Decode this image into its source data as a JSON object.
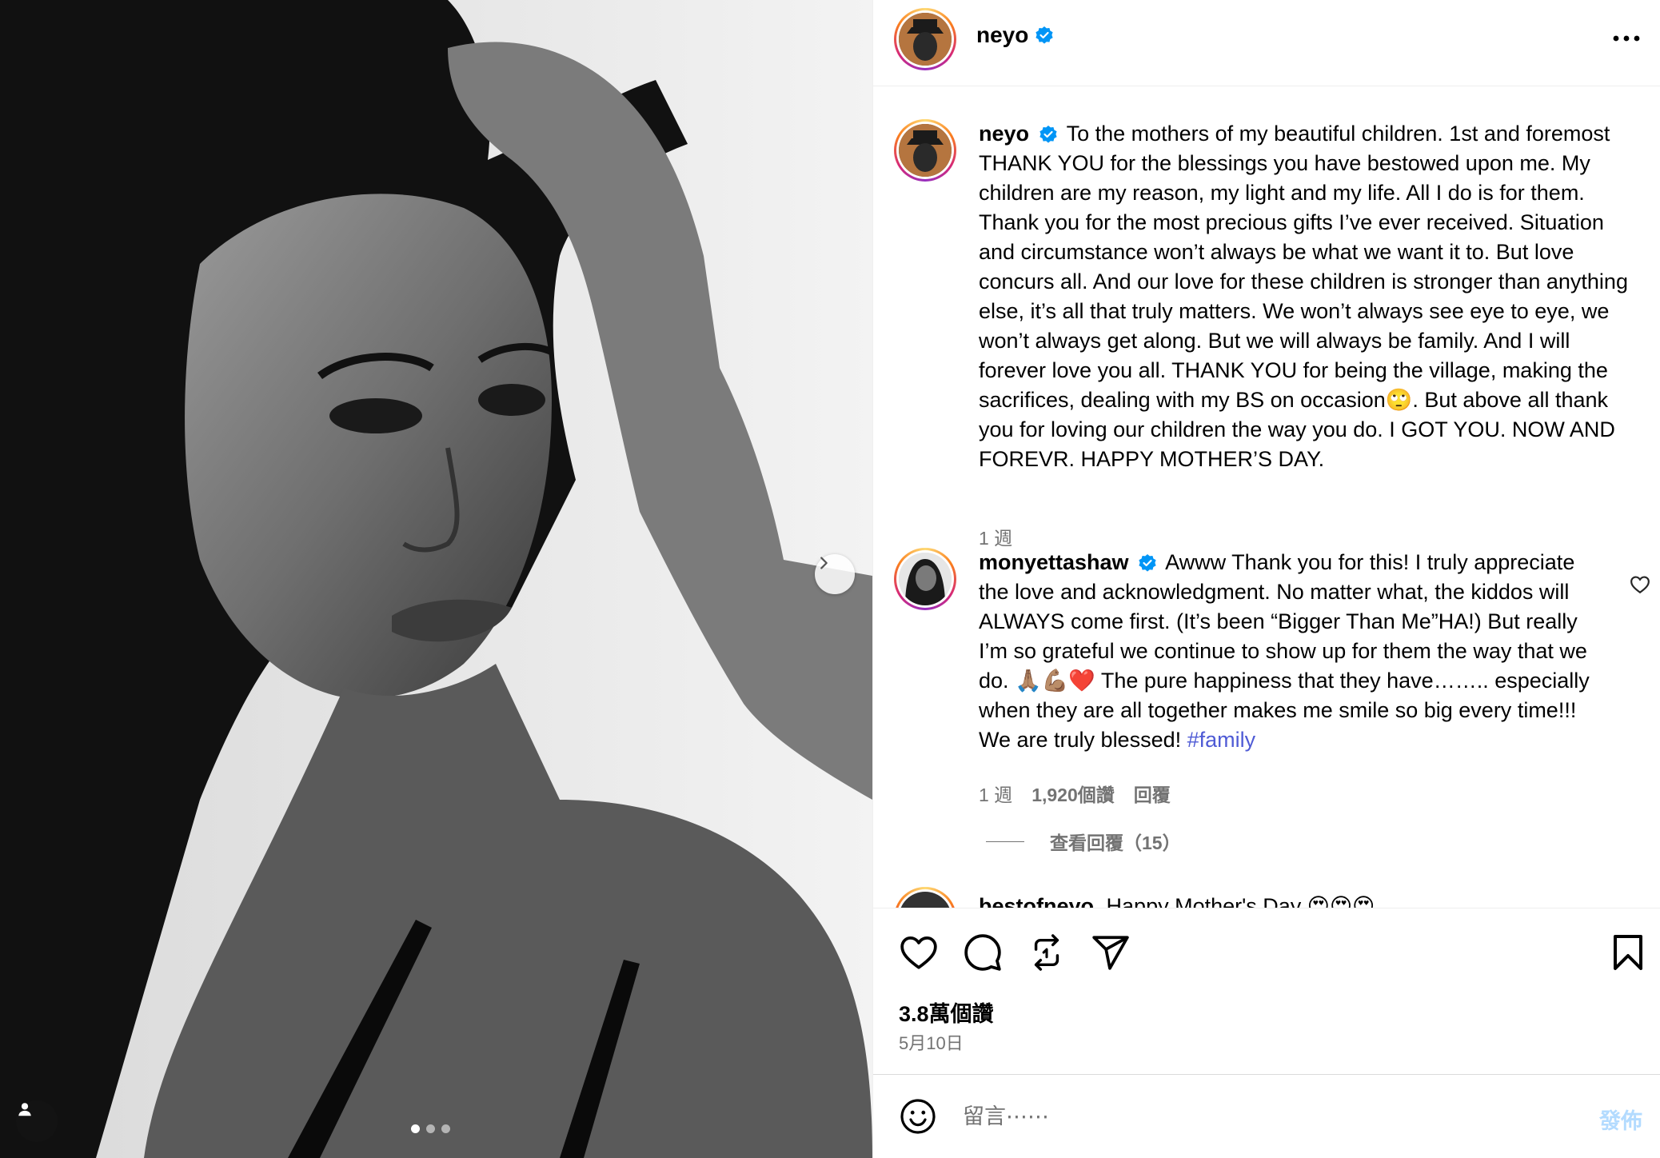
{
  "post": {
    "author": "neyo",
    "carousel_index": 1,
    "carousel_total": 3
  },
  "caption": {
    "username": "neyo",
    "text": "To the mothers of my beautiful children. 1st and foremost THANK YOU for the blessings you have bestowed upon me. My children are my reason, my light and my life. All I do is for them. Thank you for the most precious gifts I’ve ever received. Situation and circumstance won’t always be what we want it to. But love concurs all. And our love for these children is stronger than anything else, it’s all that truly matters. We won’t always see eye to eye, we won’t always get along. But we will always be family. And I will forever love you all. THANK YOU for being the village, making the sacrifices, dealing with my BS on occasion🙄. But above all thank you for loving our children the way you do. I GOT YOU. NOW AND FOREVR. HAPPY MOTHER’S DAY.",
    "time": "1 週"
  },
  "comments": [
    {
      "username": "monyettashaw",
      "text": "Awww Thank you for this! I truly appreciate the love and acknowledgment. No matter what, the kiddos will ALWAYS come first. (It’s been “Bigger Than Me”HA!) But really I’m so grateful we continue to show up for them the way that we do. 🙏🏽💪🏽❤️ The pure happiness that they have…….. especially when they are all together makes me smile so big every time!!! We are truly blessed!",
      "hashtag": "#family",
      "time": "1 週",
      "likes": "1,920個讚",
      "reply_label": "回覆",
      "view_replies": "查看回覆（15）"
    },
    {
      "username": "bestofneyo",
      "text": "Happy Mother's Day 😍😍😍"
    }
  ],
  "stats": {
    "likes": "3.8萬個讚",
    "date": "5月10日"
  },
  "composer": {
    "placeholder": "留言⋯⋯",
    "post_label": "發佈"
  },
  "colors": {
    "link": "#4f5bd5",
    "verified": "#0095f6",
    "secondary_text": "#737373",
    "post_disabled": "#b3dbff"
  },
  "icons": [
    "more-icon",
    "heart-icon",
    "comment-icon",
    "repost-icon",
    "share-icon",
    "bookmark-icon",
    "emoji-icon",
    "chevron-right-icon",
    "user-tag-icon"
  ]
}
